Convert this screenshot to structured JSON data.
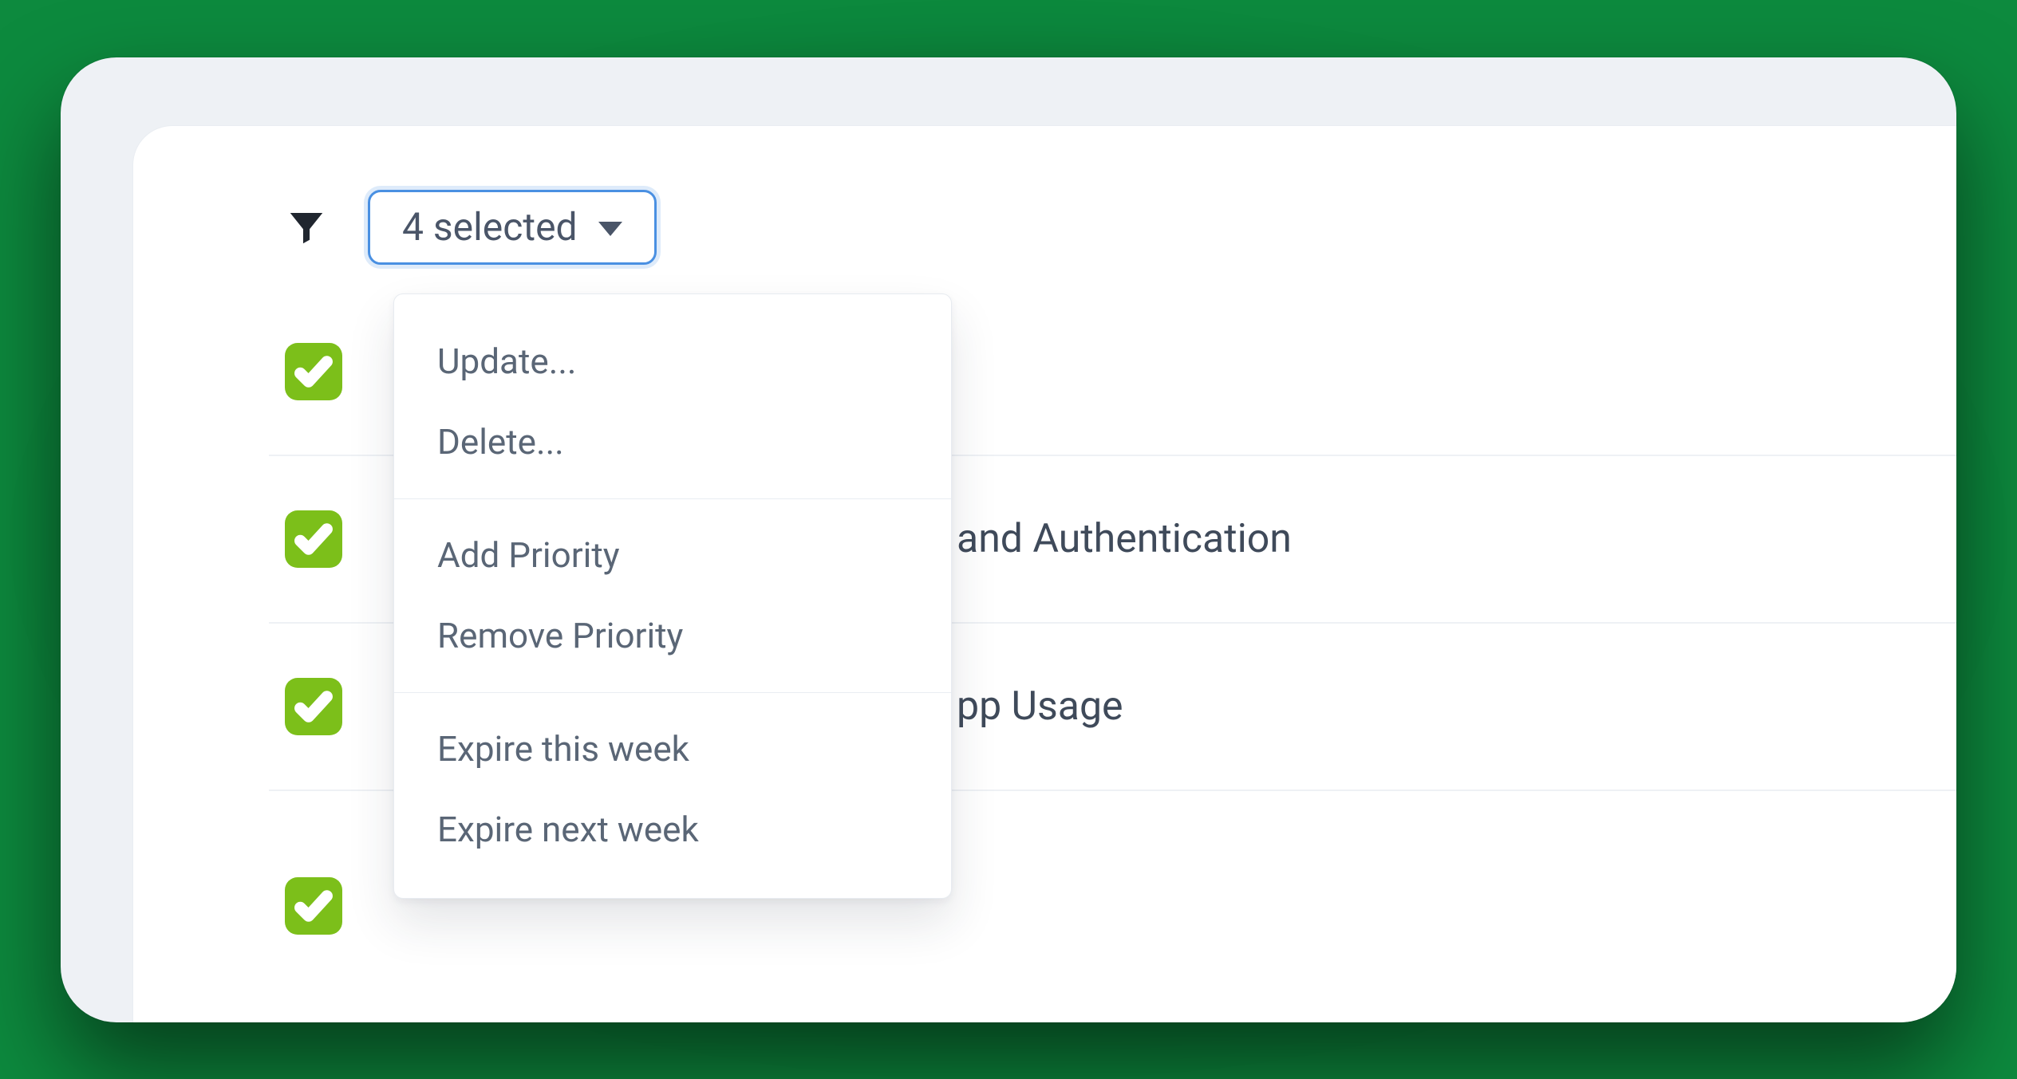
{
  "toolbar": {
    "selected_label": "4 selected"
  },
  "dropdown": {
    "groups": [
      {
        "items": [
          "Update...",
          "Delete..."
        ]
      },
      {
        "items": [
          "Add Priority",
          "Remove Priority"
        ]
      },
      {
        "items": [
          "Expire this week",
          "Expire next week"
        ]
      }
    ]
  },
  "rows": [
    {
      "checked": true,
      "title": ""
    },
    {
      "checked": true,
      "title": "and Authentication"
    },
    {
      "checked": true,
      "title": "pp Usage"
    },
    {
      "checked": true,
      "title": ""
    }
  ]
}
